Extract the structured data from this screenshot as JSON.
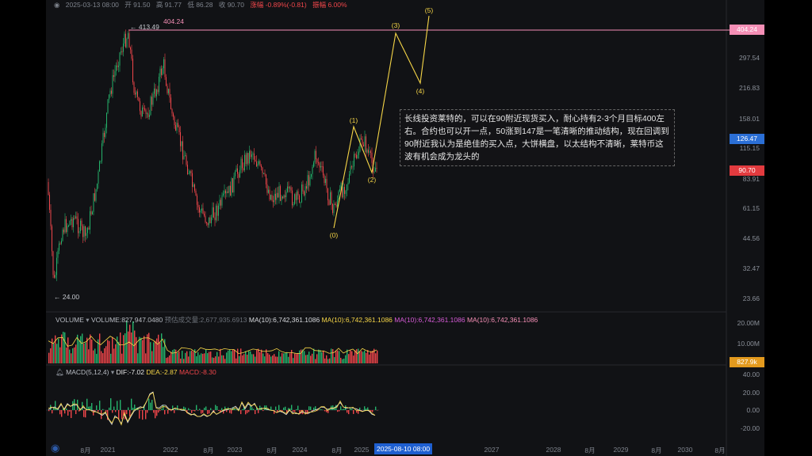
{
  "header": {
    "date": "2025-03-13 08:00",
    "open": "开 91.50",
    "high": "高 91.77",
    "low": "低 86.28",
    "close": "收 90.70",
    "change": "涨幅 -0.89%(-0.81)",
    "amplitude": "振幅 6.00%"
  },
  "price_axis": [
    "297.54",
    "216.83",
    "158.01",
    "115.15",
    "83.91",
    "61.15",
    "44.56",
    "32.47",
    "23.66"
  ],
  "tags": {
    "target_line": "404.24",
    "ma_value": "126.47",
    "last_price": "90.70",
    "volume_last": "827.9k"
  },
  "target_line_label": "404.24",
  "peak_label": "← 413.49",
  "low_label": "← 24.00",
  "waves": [
    "(0)",
    "(1)",
    "(2)",
    "(3)",
    "(4)",
    "(5)"
  ],
  "annotation": "长线投资莱特的，可以在90附近现货买入，耐心持有2-3个月目标400左右。合约也可以开一点，50涨到147是一笔清晰的推动结构，现在回调到90附近我认为是绝佳的买入点，大饼横盘，以太结构不清晰，莱特币这波有机会成为龙头的",
  "volume_panel": {
    "title": "VOLUME",
    "volume": "VOLUME:827,947.0480",
    "turnover": "预估成交量:2,677,935.6913",
    "ma1": "MA(10):6,742,361.1086",
    "ma2": "MA(10):6,742,361.1086",
    "ma3": "MA(10):6,742,361.1086",
    "ma4": "MA(10):6,742,361.1086",
    "axis": [
      "20.00M",
      "10.00M"
    ]
  },
  "macd_panel": {
    "title": "MACD(5,12,4)",
    "dif": "DIF:-7.02",
    "dea": "DEA:-2.87",
    "macd": "MACD:-8.30",
    "axis": [
      "40.00",
      "20.00",
      "0.00",
      "-20.00"
    ]
  },
  "x_axis": [
    "8月",
    "2021",
    "2022",
    "8月",
    "2023",
    "8月",
    "2024",
    "8月",
    "2025",
    "8月",
    "2027",
    "2028",
    "8月",
    "2029",
    "8月",
    "2030",
    "8月"
  ],
  "x_cursor": "2025-08-10 08:00",
  "colors": {
    "up": "#25b36b",
    "down": "#f0464a",
    "wave": "#f5d547",
    "target": "#f58fb6",
    "accent": "#1e5fd0"
  }
}
